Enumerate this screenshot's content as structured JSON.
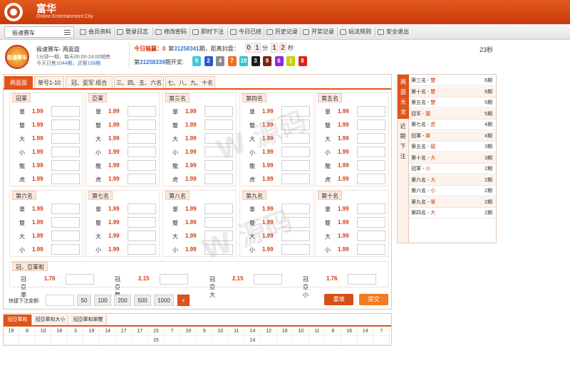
{
  "brand": {
    "title": "富华",
    "subtitle": "Online Entertainment City"
  },
  "game_select": {
    "label": "极速赛车"
  },
  "nav": [
    {
      "label": "会员资料",
      "icon": "member-icon"
    },
    {
      "label": "登录日志",
      "icon": "monitor-icon"
    },
    {
      "label": "修改密码",
      "icon": "settings-icon"
    },
    {
      "label": "即时下注",
      "icon": "screen-icon"
    },
    {
      "label": "今日已结",
      "icon": "calendar-icon"
    },
    {
      "label": "历史记录",
      "icon": "chart-icon"
    },
    {
      "label": "开奖记录",
      "icon": "gear-icon"
    },
    {
      "label": "玩法规则",
      "icon": "book-icon"
    },
    {
      "label": "安全退出",
      "icon": "power-icon"
    }
  ],
  "info": {
    "badge": "极速赛车",
    "game_name": "极速赛车- 两面盘",
    "schedule": "1分钟一期，每天00:00-24:00销售",
    "sold_prefix": "今天已售",
    "sold": "1044期",
    "remaining_prefix": "，还剩",
    "remaining": "108期",
    "win_label": "今日输赢：0",
    "period_prefix": "第",
    "period": "31258341",
    "period_suffix": "期，距离封盘：",
    "countdown": [
      "0",
      "1",
      "1",
      "2"
    ],
    "countdown_units": [
      "分",
      "秒"
    ],
    "prev_prefix": "第",
    "prev_period": "31258339",
    "prev_suffix": "期开奖:",
    "draw": [
      "5",
      "2",
      "4",
      "7",
      "10",
      "3",
      "9",
      "6",
      "1",
      "8"
    ],
    "draw_colors": [
      "#43c6d7",
      "#2b57d4",
      "#8c8c8c",
      "#f0701e",
      "#36c6c3",
      "#1b1b1b",
      "#7d2314",
      "#8a2be2",
      "#c7d000",
      "#e0201c"
    ],
    "seconds": "23秒"
  },
  "tabs": [
    "两面盘",
    "单号1-10",
    "冠、亚军 组合",
    "三、四、五、六名",
    "七、八、九、十名"
  ],
  "groups_row1": [
    {
      "title": "冠軍",
      "rows": [
        [
          "單",
          "1.99"
        ],
        [
          "雙",
          "1.99"
        ],
        [
          "大",
          "1.99"
        ],
        [
          "小",
          "1.99"
        ],
        [
          "龍",
          "1.99"
        ],
        [
          "虎",
          "1.99"
        ]
      ]
    },
    {
      "title": "亞軍",
      "rows": [
        [
          "單",
          "1.99"
        ],
        [
          "雙",
          "1.99"
        ],
        [
          "大",
          "1.99"
        ],
        [
          "小",
          "1.99"
        ],
        [
          "龍",
          "1.99"
        ],
        [
          "虎",
          "1.99"
        ]
      ]
    },
    {
      "title": "第三名",
      "rows": [
        [
          "單",
          "1.99"
        ],
        [
          "雙",
          "1.99"
        ],
        [
          "大",
          "1.99"
        ],
        [
          "小",
          "1.99"
        ],
        [
          "龍",
          "1.99"
        ],
        [
          "虎",
          "1.99"
        ]
      ]
    },
    {
      "title": "第四名",
      "rows": [
        [
          "單",
          "1.99"
        ],
        [
          "雙",
          "1.99"
        ],
        [
          "大",
          "1.99"
        ],
        [
          "小",
          "1.99"
        ],
        [
          "龍",
          "1.99"
        ],
        [
          "虎",
          "1.99"
        ]
      ]
    },
    {
      "title": "第五名",
      "rows": [
        [
          "單",
          "1.99"
        ],
        [
          "雙",
          "1.99"
        ],
        [
          "大",
          "1.99"
        ],
        [
          "小",
          "1.99"
        ],
        [
          "龍",
          "1.99"
        ],
        [
          "虎",
          "1.99"
        ]
      ]
    }
  ],
  "groups_row2": [
    {
      "title": "第六名",
      "rows": [
        [
          "單",
          "1.99"
        ],
        [
          "雙",
          "1.99"
        ],
        [
          "大",
          "1.99"
        ],
        [
          "小",
          "1.99"
        ]
      ]
    },
    {
      "title": "第七名",
      "rows": [
        [
          "單",
          "1.99"
        ],
        [
          "雙",
          "1.99"
        ],
        [
          "大",
          "1.99"
        ],
        [
          "小",
          "1.99"
        ]
      ]
    },
    {
      "title": "第八名",
      "rows": [
        [
          "單",
          "1.99"
        ],
        [
          "雙",
          "1.99"
        ],
        [
          "大",
          "1.99"
        ],
        [
          "小",
          "1.99"
        ]
      ]
    },
    {
      "title": "第九名",
      "rows": [
        [
          "單",
          "1.99"
        ],
        [
          "雙",
          "1.99"
        ],
        [
          "大",
          "1.99"
        ],
        [
          "小",
          "1.99"
        ]
      ]
    },
    {
      "title": "第十名",
      "rows": [
        [
          "單",
          "1.99"
        ],
        [
          "雙",
          "1.99"
        ],
        [
          "大",
          "1.99"
        ],
        [
          "小",
          "1.99"
        ]
      ]
    }
  ],
  "gyh": {
    "title": "冠、亞軍和",
    "items": [
      {
        "name": "冠亞單",
        "odds": "1.76"
      },
      {
        "name": "冠亞雙",
        "odds": "2.15"
      },
      {
        "name": "冠亞大",
        "odds": "2.15"
      },
      {
        "name": "冠亞小",
        "odds": "1.76"
      }
    ]
  },
  "quick": {
    "label": "快捷下注金额:",
    "chips": [
      "50",
      "100",
      "200",
      "500",
      "1000"
    ],
    "plus": "+",
    "reset": "重填",
    "submit": "提交"
  },
  "bottom_tabs": [
    "冠亞軍和",
    "冠亞軍和大小",
    "冠亞軍和單雙"
  ],
  "history_row1": [
    "19",
    "8",
    "10",
    "18",
    "3",
    "19",
    "14",
    "17",
    "17",
    "15",
    "7",
    "19",
    "9",
    "10",
    "11",
    "14",
    "12",
    "18",
    "10",
    "11",
    "8",
    "16",
    "14",
    "7"
  ],
  "history_row2": [
    "",
    "",
    "",
    "",
    "",
    "",
    "",
    "",
    "",
    "15",
    "",
    "",
    "",
    "",
    "",
    "14",
    "",
    "",
    "",
    "",
    "",
    "",
    "",
    ""
  ],
  "right": {
    "tab_active": "两面长龙",
    "tab_other": "近期下注",
    "rows": [
      {
        "name": "第三名",
        "val": "雙",
        "count": "6期"
      },
      {
        "name": "第十名",
        "val": "雙",
        "count": "6期"
      },
      {
        "name": "第五名",
        "val": "雙",
        "count": "5期"
      },
      {
        "name": "冠军",
        "val": "龍",
        "count": "5期"
      },
      {
        "name": "第七名",
        "val": "虎",
        "count": "4期"
      },
      {
        "name": "冠軍",
        "val": "單",
        "count": "4期"
      },
      {
        "name": "第五名",
        "val": "龍",
        "count": "3期"
      },
      {
        "name": "第十名",
        "val": "大",
        "count": "3期"
      },
      {
        "name": "冠軍",
        "val": "小",
        "count": "2期"
      },
      {
        "name": "第六名",
        "val": "大",
        "count": "2期"
      },
      {
        "name": "第六名",
        "val": "小",
        "count": "2期"
      },
      {
        "name": "第九名",
        "val": "單",
        "count": "2期"
      },
      {
        "name": "第四名",
        "val": "大",
        "count": "2期"
      }
    ]
  }
}
